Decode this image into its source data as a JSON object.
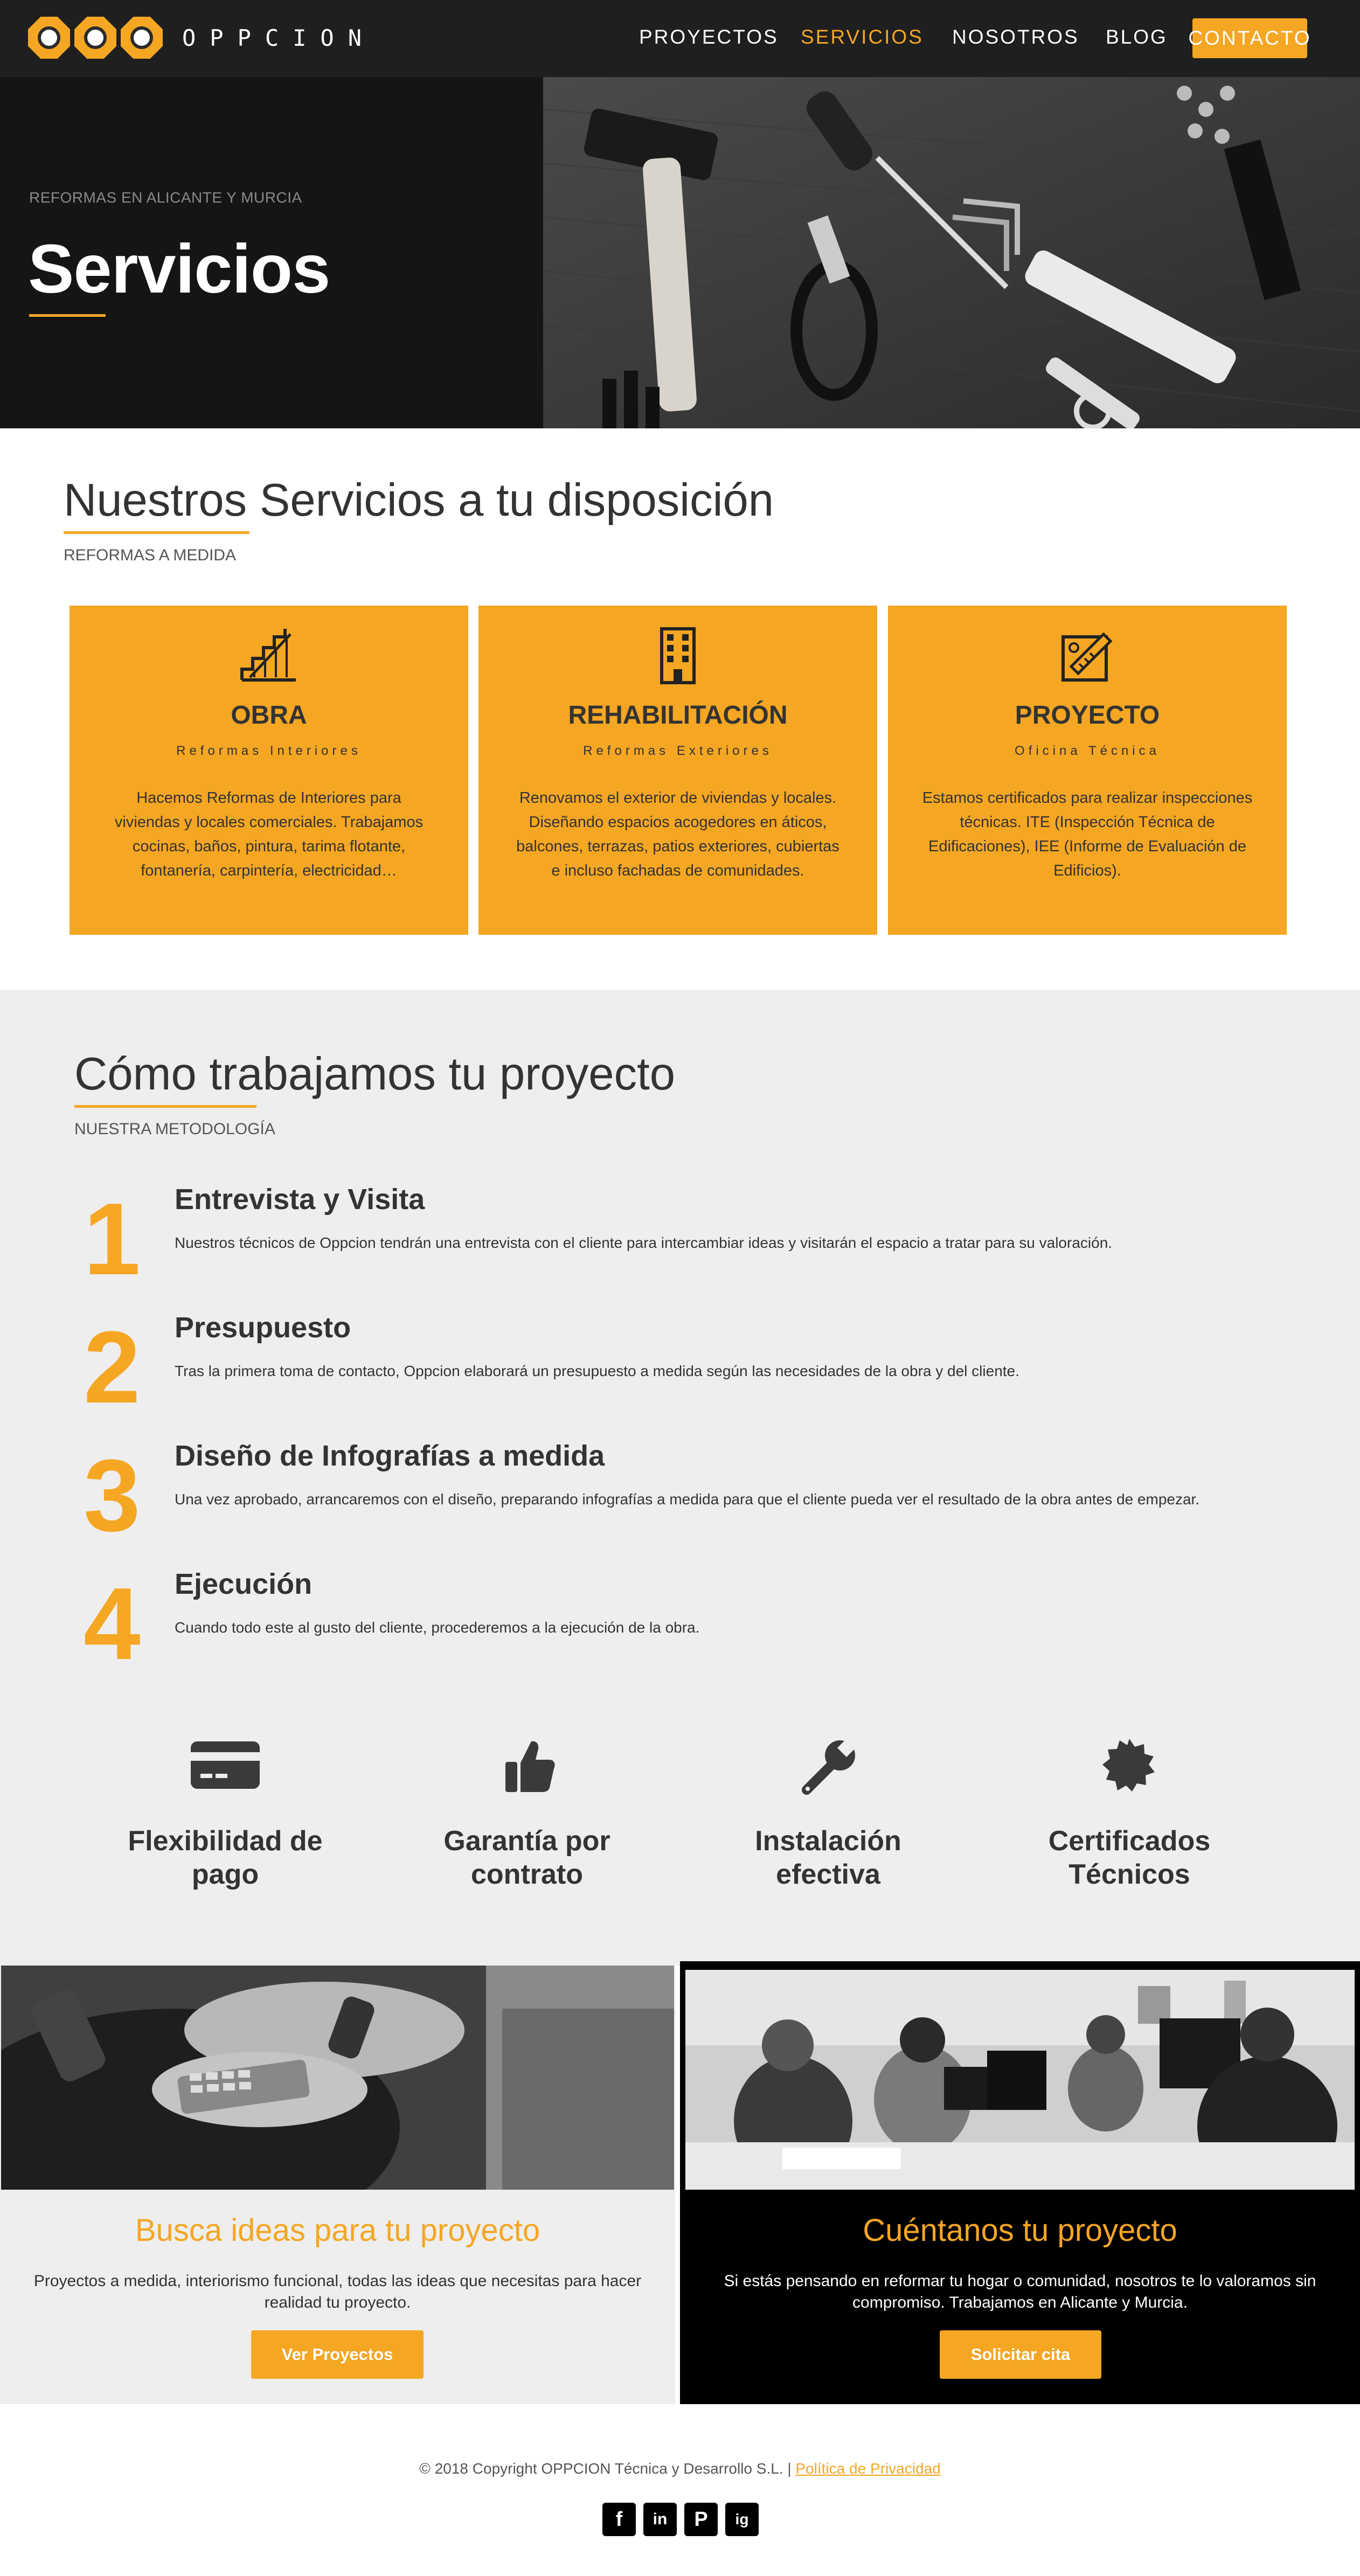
{
  "nav": {
    "logo_text": "OPPCION",
    "links": [
      "PROYECTOS",
      "SERVICIOS",
      "NOSOTROS",
      "BLOG"
    ],
    "active": "SERVICIOS",
    "contact": "CONTACTO"
  },
  "hero": {
    "subtitle": "REFORMAS EN ALICANTE Y MURCIA",
    "title": "Servicios"
  },
  "services": {
    "title": "Nuestros Servicios a tu disposición",
    "subtitle": "REFORMAS A MEDIDA",
    "cards": [
      {
        "icon": "stairs-icon",
        "title": "OBRA",
        "tag": "Reformas Interiores",
        "text": "Hacemos Reformas de Interiores para viviendas y locales comerciales. Trabajamos cocinas, baños, pintura, tarima flotante, fontanería, carpintería, electricidad…"
      },
      {
        "icon": "building-icon",
        "title": "REHABILITACIÓN",
        "tag": "Reformas Exteriores",
        "text": "Renovamos el exterior de viviendas y locales. Diseñando espacios acogedores en áticos, balcones, terrazas, patios exteriores, cubiertas e incluso fachadas de comunidades."
      },
      {
        "icon": "blueprint-icon",
        "title": "PROYECTO",
        "tag": "Oficina Técnica",
        "text": "Estamos certificados para realizar inspecciones técnicas. ITE (Inspección Técnica de Edificaciones), IEE (Informe de Evaluación de Edificios)."
      }
    ]
  },
  "method": {
    "title": "Cómo trabajamos tu proyecto",
    "subtitle": "NUESTRA METODOLOGÍA",
    "steps": [
      {
        "num": "1",
        "title": "Entrevista y Visita",
        "text": "Nuestros técnicos de Oppcion tendrán una entrevista con el cliente para intercambiar ideas y visitarán el espacio a tratar para su valoración."
      },
      {
        "num": "2",
        "title": "Presupuesto",
        "text": "Tras la primera toma de contacto, Oppcion elaborará un presupuesto a medida según las necesidades de la obra y del cliente."
      },
      {
        "num": "3",
        "title": "Diseño de Infografías a medida",
        "text": "Una vez aprobado, arrancaremos con el diseño, preparando infografías a medida para que el cliente pueda ver el resultado de la obra antes de empezar."
      },
      {
        "num": "4",
        "title": "Ejecución",
        "text": "Cuando todo este al gusto del cliente, procederemos a la ejecución de la obra."
      }
    ],
    "features": [
      {
        "icon": "credit-card-icon",
        "label": "Flexibilidad de pago"
      },
      {
        "icon": "thumbs-up-icon",
        "label": "Garantía por contrato"
      },
      {
        "icon": "wrench-icon",
        "label": "Instalación efectiva"
      },
      {
        "icon": "certificate-icon",
        "label": "Certificados Técnicos"
      }
    ]
  },
  "cta": {
    "left": {
      "title": "Busca ideas para tu proyecto",
      "text": "Proyectos a medida, interiorismo funcional, todas las ideas que necesitas para hacer realidad tu proyecto.",
      "button": "Ver Proyectos"
    },
    "right": {
      "title": "Cuéntanos tu proyecto",
      "text": "Si estás pensando en reformar tu hogar o comunidad, nosotros te lo valoramos sin compromiso. Trabajamos en Alicante y Murcia.",
      "button": "Solicitar cita"
    }
  },
  "footer": {
    "copyright": "© 2018 Copyright OPPCION Técnica y Desarrollo S.L. |",
    "privacy": "Política de Privacidad",
    "social": [
      "f",
      "in",
      "P",
      "ig"
    ]
  },
  "colors": {
    "accent": "#f5a623",
    "dark": "#1f1f1f",
    "gray_bg": "#eeeeee"
  }
}
